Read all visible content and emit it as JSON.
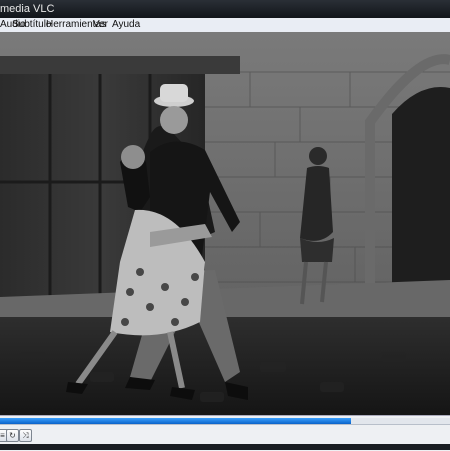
{
  "window": {
    "title": "media VLC"
  },
  "menu": {
    "items": [
      "Audio",
      "Subtítulo",
      "Herramientas",
      "Ver",
      "Ayuda"
    ]
  },
  "playback": {
    "progress_fraction": 0.78
  },
  "controls": {
    "icons": [
      "playlist-icon",
      "loop-icon",
      "shuffle-icon"
    ]
  },
  "colors": {
    "seek_fill": "#1e7fe8",
    "menubar_bg": "#e9edf4"
  }
}
